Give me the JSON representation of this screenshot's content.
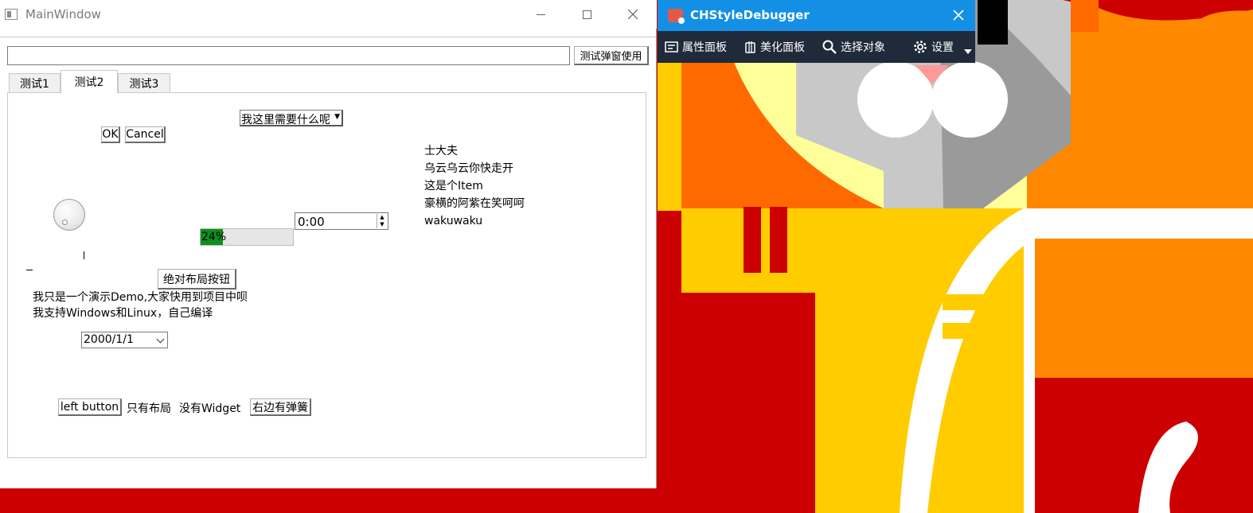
{
  "main_window": {
    "title": "MainWindow",
    "top_input_value": "",
    "popup_button": "测试弹窗使用",
    "tabs": [
      {
        "label": "测试1"
      },
      {
        "label": "测试2"
      },
      {
        "label": "测试3"
      }
    ],
    "active_tab": "测试2",
    "combo_box": {
      "selected": "我这里需要什么呢"
    },
    "ok_button": "OK",
    "cancel_button": "Cancel",
    "list_items": [
      "士大夫",
      "乌云乌云你快走开",
      "这是个Item",
      "豪横的阿紫在笑呵呵",
      "wakuwaku"
    ],
    "progress": {
      "text": "24%",
      "value": 24
    },
    "time_edit": {
      "value": "0:00"
    },
    "absolute_button": "绝对布局按钮",
    "demo_lines": [
      "我只是一个演示Demo,大家快用到项目中呗",
      "我支持Windows和Linux，自己编译"
    ],
    "date_combo": {
      "value": "2000/1/1"
    },
    "left_button": "left button",
    "layout_only_label": "只有布局",
    "no_widget_label": "没有Widget",
    "right_spring_button": "右边有弹簧"
  },
  "debugger": {
    "title": "CHStyleDebugger",
    "toolbar": [
      {
        "label": "属性面板",
        "icon": "property-panel-icon"
      },
      {
        "label": "美化面板",
        "icon": "style-panel-icon"
      },
      {
        "label": "选择对象",
        "icon": "search-icon"
      },
      {
        "label": "设置",
        "icon": "gear-icon"
      }
    ],
    "accent_color": "#1390e6",
    "toolbar_color": "#1f2a3a"
  },
  "wallpaper": {
    "colors": [
      "#cc0000",
      "#ff6600",
      "#ffcc00",
      "#ffff99",
      "#cccccc",
      "#999999",
      "#ffffff"
    ]
  }
}
